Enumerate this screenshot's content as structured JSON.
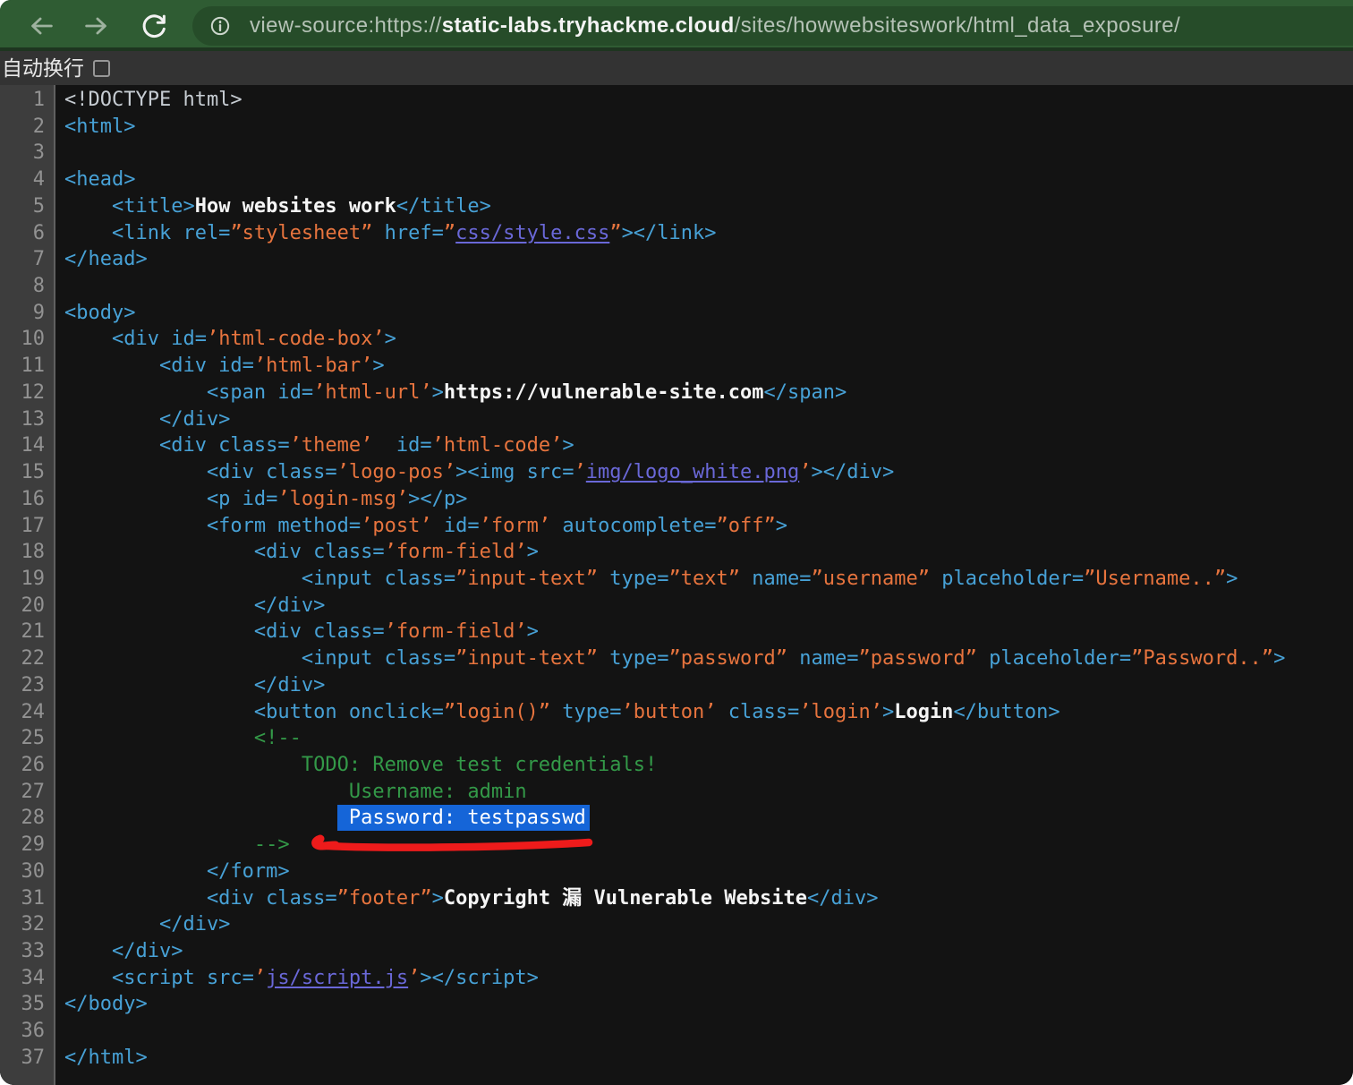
{
  "browser": {
    "url_prefix": "view-source:https://",
    "url_domain": "static-labs.tryhackme.cloud",
    "url_path": "/sites/howwebsiteswork/html_data_exposure/",
    "back_icon": "back-arrow",
    "forward_icon": "forward-arrow",
    "reload_icon": "reload-circular-arrow",
    "info_icon": "page-info-circle"
  },
  "wrap_bar": {
    "label": "自动换行",
    "checkbox_checked": false
  },
  "colors": {
    "toolbar_green": "#2f5c33",
    "urlbar_green": "#264c29",
    "toolbar_border_green": "#1e3520",
    "wrapbar_bg": "#333333",
    "code_bg": "#131313",
    "gutter_bg": "#3d3d3d",
    "gutter_text": "#929292",
    "syntax_tag": "#47a1d6",
    "syntax_value": "#e7743e",
    "syntax_comment": "#339948",
    "syntax_text": "#f5f5f5",
    "syntax_doctype": "#c6ccd2",
    "syntax_link": "#6a68d8",
    "selection_bg": "#1565d8",
    "selection_text": "#ffffff",
    "annotation_red": "#ee1b1b",
    "url_text_secondary": "#b5c2b6",
    "url_text_domain": "#f4f4f4"
  },
  "source": {
    "lines": [
      {
        "n": 1,
        "tokens": [
          [
            "d",
            "<!DOCTYPE html>"
          ]
        ]
      },
      {
        "n": 2,
        "tokens": [
          [
            "t",
            "<html>"
          ]
        ]
      },
      {
        "n": 3,
        "tokens": []
      },
      {
        "n": 4,
        "tokens": [
          [
            "t",
            "<head>"
          ]
        ]
      },
      {
        "n": 5,
        "tokens": [
          [
            "t",
            "    <title>"
          ],
          [
            "x",
            "How websites work"
          ],
          [
            "t",
            "</title>"
          ]
        ]
      },
      {
        "n": 6,
        "tokens": [
          [
            "t",
            "    <link rel="
          ],
          [
            "v",
            "”stylesheet”"
          ],
          [
            "t",
            " href="
          ],
          [
            "v",
            "”"
          ],
          [
            "l",
            "css/style.css"
          ],
          [
            "v",
            "”"
          ],
          [
            "t",
            "></link>"
          ]
        ]
      },
      {
        "n": 7,
        "tokens": [
          [
            "t",
            "</head>"
          ]
        ]
      },
      {
        "n": 8,
        "tokens": []
      },
      {
        "n": 9,
        "tokens": [
          [
            "t",
            "<body>"
          ]
        ]
      },
      {
        "n": 10,
        "tokens": [
          [
            "t",
            "    <div id="
          ],
          [
            "v",
            "’html-code-box’"
          ],
          [
            "t",
            ">"
          ]
        ]
      },
      {
        "n": 11,
        "tokens": [
          [
            "t",
            "        <div id="
          ],
          [
            "v",
            "’html-bar’"
          ],
          [
            "t",
            ">"
          ]
        ]
      },
      {
        "n": 12,
        "tokens": [
          [
            "t",
            "            <span id="
          ],
          [
            "v",
            "’html-url’"
          ],
          [
            "t",
            ">"
          ],
          [
            "x",
            "https://vulnerable-site.com"
          ],
          [
            "t",
            "</span>"
          ]
        ]
      },
      {
        "n": 13,
        "tokens": [
          [
            "t",
            "        </div>"
          ]
        ]
      },
      {
        "n": 14,
        "tokens": [
          [
            "t",
            "        <div class="
          ],
          [
            "v",
            "’theme’"
          ],
          [
            "t",
            "  id="
          ],
          [
            "v",
            "’html-code’"
          ],
          [
            "t",
            ">"
          ]
        ]
      },
      {
        "n": 15,
        "tokens": [
          [
            "t",
            "            <div class="
          ],
          [
            "v",
            "’logo-pos’"
          ],
          [
            "t",
            "><img src="
          ],
          [
            "v",
            "’"
          ],
          [
            "l",
            "img/logo_white.png"
          ],
          [
            "v",
            "’"
          ],
          [
            "t",
            "></div>"
          ]
        ]
      },
      {
        "n": 16,
        "tokens": [
          [
            "t",
            "            <p id="
          ],
          [
            "v",
            "’login-msg’"
          ],
          [
            "t",
            "></p>"
          ]
        ]
      },
      {
        "n": 17,
        "tokens": [
          [
            "t",
            "            <form method="
          ],
          [
            "v",
            "’post’"
          ],
          [
            "t",
            " id="
          ],
          [
            "v",
            "’form’"
          ],
          [
            "t",
            " autocomplete="
          ],
          [
            "v",
            "”off”"
          ],
          [
            "t",
            ">"
          ]
        ]
      },
      {
        "n": 18,
        "tokens": [
          [
            "t",
            "                <div class="
          ],
          [
            "v",
            "’form-field’"
          ],
          [
            "t",
            ">"
          ]
        ]
      },
      {
        "n": 19,
        "tokens": [
          [
            "t",
            "                    <input class="
          ],
          [
            "v",
            "”input-text”"
          ],
          [
            "t",
            " type="
          ],
          [
            "v",
            "”text”"
          ],
          [
            "t",
            " name="
          ],
          [
            "v",
            "”username”"
          ],
          [
            "t",
            " placeholder="
          ],
          [
            "v",
            "”Username..”"
          ],
          [
            "t",
            ">"
          ]
        ]
      },
      {
        "n": 20,
        "tokens": [
          [
            "t",
            "                </div>"
          ]
        ]
      },
      {
        "n": 21,
        "tokens": [
          [
            "t",
            "                <div class="
          ],
          [
            "v",
            "’form-field’"
          ],
          [
            "t",
            ">"
          ]
        ]
      },
      {
        "n": 22,
        "tokens": [
          [
            "t",
            "                    <input class="
          ],
          [
            "v",
            "”input-text”"
          ],
          [
            "t",
            " type="
          ],
          [
            "v",
            "”password”"
          ],
          [
            "t",
            " name="
          ],
          [
            "v",
            "”password”"
          ],
          [
            "t",
            " placeholder="
          ],
          [
            "v",
            "”Password..”"
          ],
          [
            "t",
            ">"
          ]
        ]
      },
      {
        "n": 23,
        "tokens": [
          [
            "t",
            "                </div>"
          ]
        ]
      },
      {
        "n": 24,
        "tokens": [
          [
            "t",
            "                <button onclick="
          ],
          [
            "v",
            "”login()”"
          ],
          [
            "t",
            " type="
          ],
          [
            "v",
            "’button’"
          ],
          [
            "t",
            " class="
          ],
          [
            "v",
            "’login’"
          ],
          [
            "t",
            ">"
          ],
          [
            "x",
            "Login"
          ],
          [
            "t",
            "</button>"
          ]
        ]
      },
      {
        "n": 25,
        "tokens": [
          [
            "c",
            "                <!--"
          ]
        ]
      },
      {
        "n": 26,
        "tokens": [
          [
            "c",
            "                    TODO: Remove test credentials!"
          ]
        ]
      },
      {
        "n": 27,
        "tokens": [
          [
            "c",
            "                        Username: admin"
          ]
        ]
      },
      {
        "n": 28,
        "tokens": [
          [
            "c",
            "                       "
          ],
          [
            "s",
            " Password: testpasswd"
          ]
        ]
      },
      {
        "n": 29,
        "tokens": [
          [
            "c",
            "                -->"
          ]
        ]
      },
      {
        "n": 30,
        "tokens": [
          [
            "t",
            "            </form>"
          ]
        ]
      },
      {
        "n": 31,
        "tokens": [
          [
            "t",
            "            <div class="
          ],
          [
            "v",
            "”footer”"
          ],
          [
            "t",
            ">"
          ],
          [
            "x",
            "Copyright 漏 Vulnerable Website"
          ],
          [
            "t",
            "</div>"
          ]
        ]
      },
      {
        "n": 32,
        "tokens": [
          [
            "t",
            "        </div>"
          ]
        ]
      },
      {
        "n": 33,
        "tokens": [
          [
            "t",
            "    </div>"
          ]
        ]
      },
      {
        "n": 34,
        "tokens": [
          [
            "t",
            "    <script src="
          ],
          [
            "v",
            "’"
          ],
          [
            "l",
            "js/script.js"
          ],
          [
            "v",
            "’"
          ],
          [
            "t",
            "></script>"
          ]
        ]
      },
      {
        "n": 35,
        "tokens": [
          [
            "t",
            "</body>"
          ]
        ]
      },
      {
        "n": 36,
        "tokens": []
      },
      {
        "n": 37,
        "tokens": [
          [
            "t",
            "</html>"
          ]
        ]
      }
    ]
  }
}
